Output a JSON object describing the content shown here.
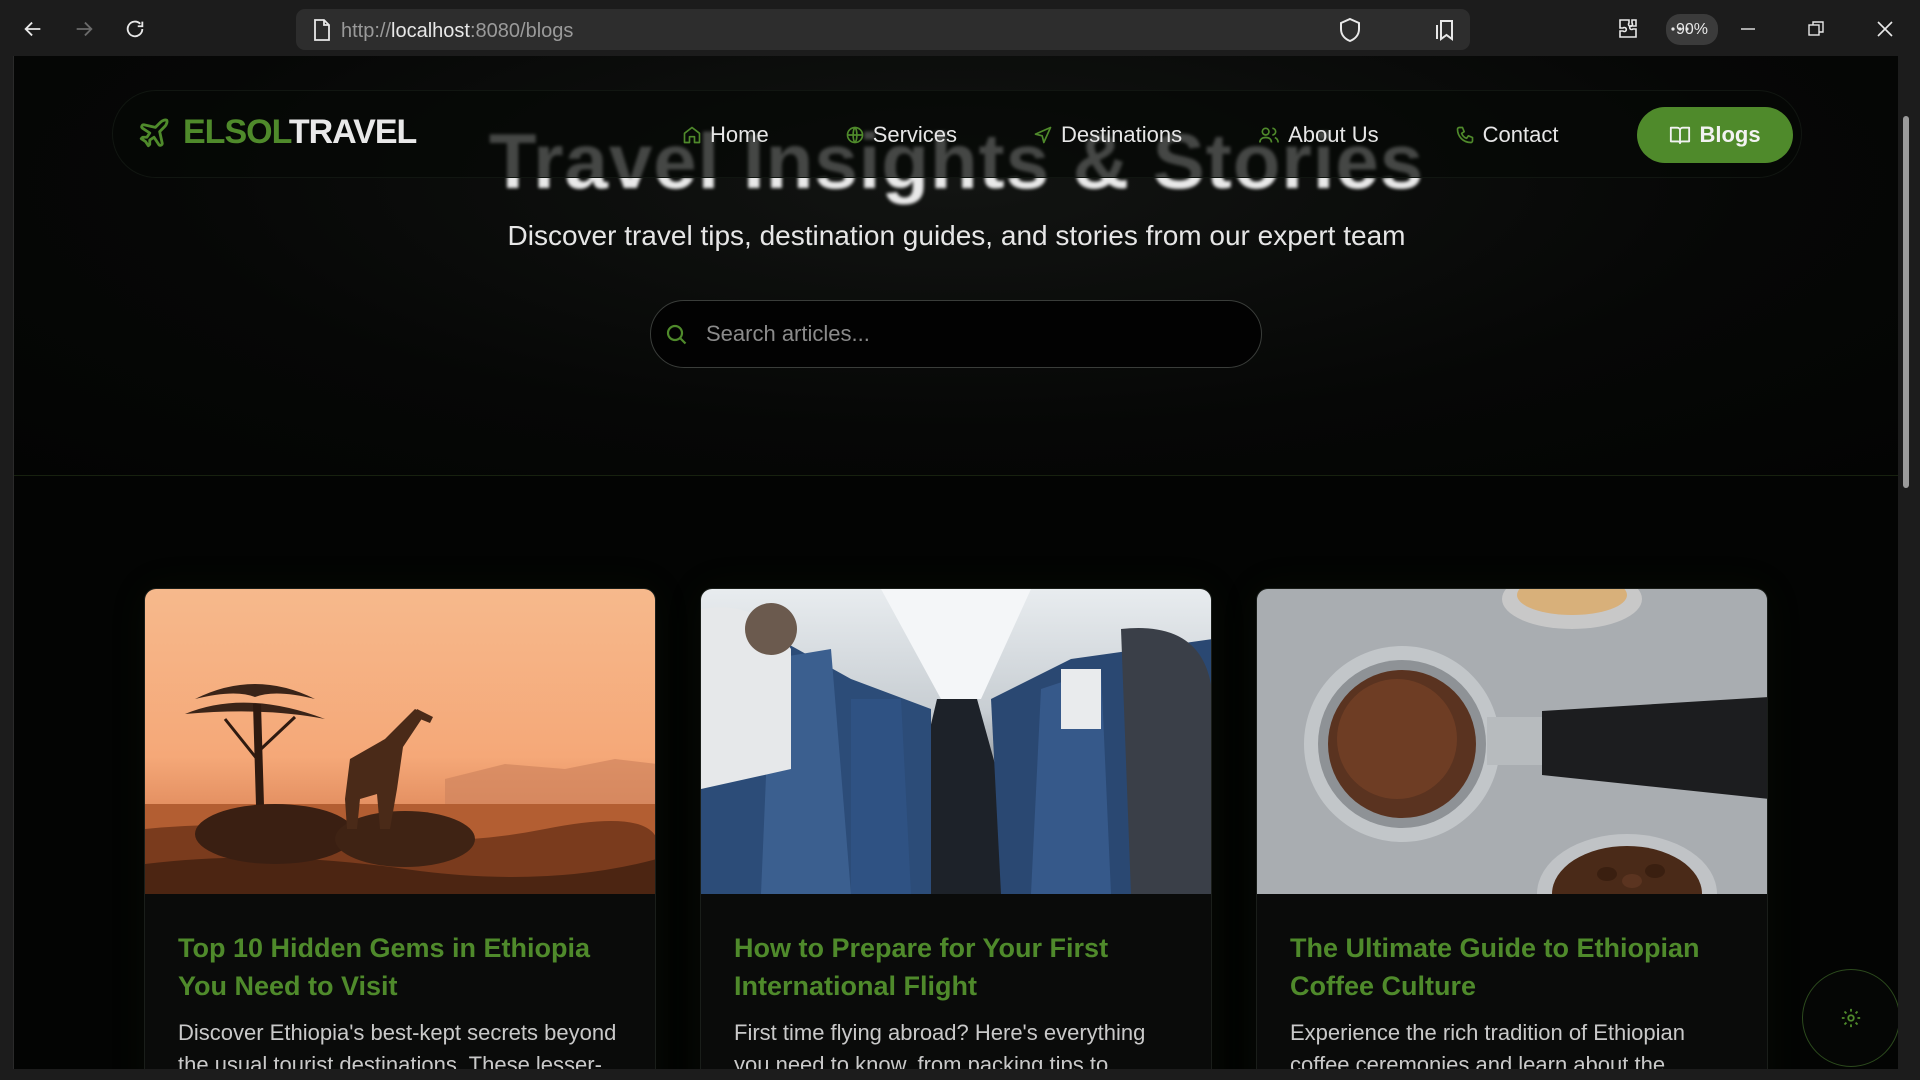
{
  "browser": {
    "url_prefix": "http://",
    "url_host": "localhost",
    "url_rest": ":8080/blogs",
    "zoom": "90%"
  },
  "nav": {
    "brand_part1": "ELSOL",
    "brand_part2": "TRAVEL",
    "items": [
      {
        "label": "Home",
        "icon": "home-icon"
      },
      {
        "label": "Services",
        "icon": "globe-icon"
      },
      {
        "label": "Destinations",
        "icon": "navigation-icon"
      },
      {
        "label": "About Us",
        "icon": "users-icon"
      },
      {
        "label": "Contact",
        "icon": "phone-icon"
      }
    ],
    "active_label": "Blogs",
    "accent": "#4f8a2b"
  },
  "hero": {
    "title": "Travel Insights & Stories",
    "subtitle": "Discover travel tips, destination guides, and stories from our expert team",
    "search_placeholder": "Search articles..."
  },
  "posts": [
    {
      "title": "Top 10 Hidden Gems in Ethiopia You Need to Visit",
      "excerpt": "Discover Ethiopia's best-kept secrets beyond the usual tourist destinations. These lesser-",
      "image": "giraffe-savanna-sunset"
    },
    {
      "title": "How to Prepare for Your First International Flight",
      "excerpt": "First time flying abroad? Here's everything you need to know, from packing tips to",
      "image": "airplane-cabin-aisle"
    },
    {
      "title": "The Ultimate Guide to Ethiopian Coffee Culture",
      "excerpt": "Experience the rich tradition of Ethiopian coffee ceremonies and learn about the",
      "image": "coffee-portafilter"
    }
  ]
}
